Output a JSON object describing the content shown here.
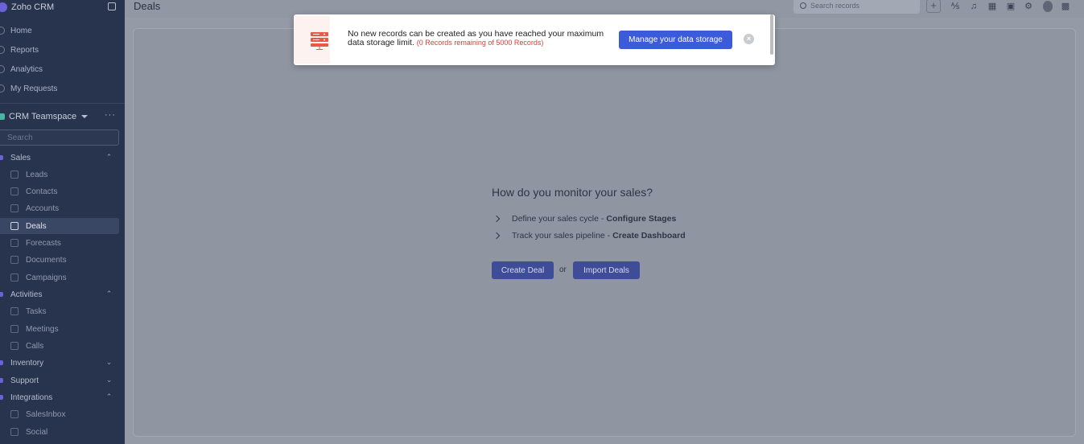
{
  "app": {
    "name": "Zoho CRM"
  },
  "sidebar": {
    "nav": [
      {
        "label": "Home",
        "icon": "home-icon"
      },
      {
        "label": "Reports",
        "icon": "reports-icon"
      },
      {
        "label": "Analytics",
        "icon": "analytics-icon"
      },
      {
        "label": "My Requests",
        "icon": "requests-icon"
      }
    ],
    "teamspace": {
      "label": "CRM Teamspace",
      "more": "···"
    },
    "search_placeholder": "Search",
    "groups": [
      {
        "label": "Sales",
        "expanded": true
      },
      {
        "label": "Activities",
        "expanded": true
      },
      {
        "label": "Inventory",
        "expanded": false
      },
      {
        "label": "Support",
        "expanded": false
      },
      {
        "label": "Integrations",
        "expanded": true
      }
    ],
    "sales_items": [
      "Leads",
      "Contacts",
      "Accounts",
      "Deals",
      "Forecasts",
      "Documents",
      "Campaigns"
    ],
    "activity_items": [
      "Tasks",
      "Meetings",
      "Calls"
    ],
    "integration_items": [
      "SalesInbox",
      "Social"
    ],
    "active_item": "Deals"
  },
  "topbar": {
    "title": "Deals",
    "search_placeholder": "Search records",
    "plus": "+"
  },
  "banner": {
    "message": "No new records can be created as you have reached your maximum data storage limit.",
    "warning": "(0 Records remaining of 5000 Records)",
    "button": "Manage your data storage",
    "close": "×"
  },
  "empty_state": {
    "question": "How do you monitor your sales?",
    "rows": [
      {
        "text": "Define your sales cycle -",
        "link": "Configure Stages"
      },
      {
        "text": "Track your sales pipeline -",
        "link": "Create Dashboard"
      }
    ],
    "create_button": "Create Deal",
    "or": "or",
    "import_button": "Import Deals"
  },
  "colors": {
    "sidebar_bg": "#28344d",
    "accent": "#3b5bd9",
    "warning": "#e03a3a"
  }
}
